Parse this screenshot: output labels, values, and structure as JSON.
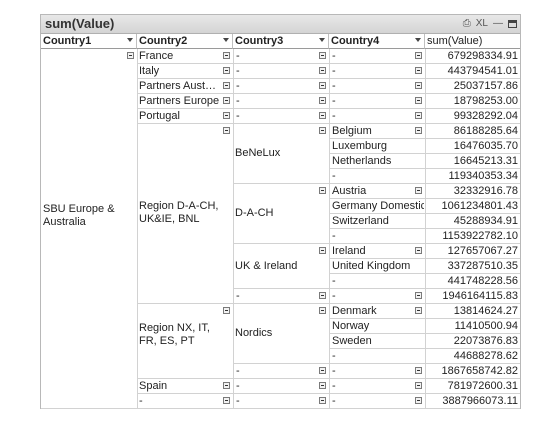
{
  "window": {
    "title": "sum(Value)",
    "xl_label": "XL"
  },
  "columns": [
    "Country1",
    "Country2",
    "Country3",
    "Country4",
    "sum(Value)"
  ],
  "country1": "SBU Europe & Australia",
  "country2": [
    "France",
    "Italy",
    "Partners Aust…",
    "Partners Europe",
    "Portugal",
    "Region D-A-CH, UK&IE, BNL",
    "Region NX, IT, FR, ES, PT",
    "Spain",
    "-"
  ],
  "country3": [
    "BeNeLux",
    "D-A-CH",
    "UK & Ireland",
    "Nordics"
  ],
  "dash": "-",
  "rows": [
    {
      "country4": "-",
      "value": "679298334.91"
    },
    {
      "country4": "-",
      "value": "443794541.01"
    },
    {
      "country4": "-",
      "value": "25037157.86"
    },
    {
      "country4": "-",
      "value": "18798253.00"
    },
    {
      "country4": "-",
      "value": "99328292.04"
    },
    {
      "country4": "Belgium",
      "value": "86188285.64"
    },
    {
      "country4": "Luxemburg",
      "value": "16476035.70"
    },
    {
      "country4": "Netherlands",
      "value": "16645213.31"
    },
    {
      "country4": "-",
      "value": "119340353.34"
    },
    {
      "country4": "Austria",
      "value": "32332916.78"
    },
    {
      "country4": "Germany Domestic",
      "value": "1061234801.43"
    },
    {
      "country4": "Switzerland",
      "value": "45288934.91"
    },
    {
      "country4": "-",
      "value": "1153922782.10"
    },
    {
      "country4": "Ireland",
      "value": "127657067.27"
    },
    {
      "country4": "United Kingdom",
      "value": "337287510.35"
    },
    {
      "country4": "-",
      "value": "441748228.56"
    },
    {
      "country4": "-",
      "value": "1946164115.83"
    },
    {
      "country4": "Denmark",
      "value": "13814624.27"
    },
    {
      "country4": "Norway",
      "value": "11410500.94"
    },
    {
      "country4": "Sweden",
      "value": "22073876.83"
    },
    {
      "country4": "-",
      "value": "44688278.62"
    },
    {
      "country4": "-",
      "value": "1867658742.82"
    },
    {
      "country4": "-",
      "value": "781972600.31"
    },
    {
      "country4": "-",
      "value": "3887966073.11"
    }
  ]
}
